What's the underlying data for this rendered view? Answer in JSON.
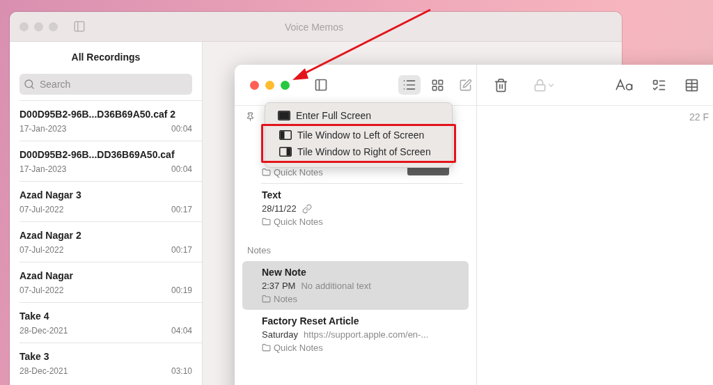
{
  "voice_memos": {
    "title": "Voice Memos",
    "heading": "All Recordings",
    "search": {
      "placeholder": "Search"
    },
    "recordings": [
      {
        "name": "D00D95B2-96B...D36B69A50.caf 2",
        "date": "17-Jan-2023",
        "duration": "00:04"
      },
      {
        "name": "D00D95B2-96B...DD36B69A50.caf",
        "date": "17-Jan-2023",
        "duration": "00:04"
      },
      {
        "name": "Azad Nagar 3",
        "date": "07-Jul-2022",
        "duration": "00:17"
      },
      {
        "name": "Azad Nagar 2",
        "date": "07-Jul-2022",
        "duration": "00:17"
      },
      {
        "name": "Azad Nagar",
        "date": "07-Jul-2022",
        "duration": "00:19"
      },
      {
        "name": "Take 4",
        "date": "28-Dec-2021",
        "duration": "04:04"
      },
      {
        "name": "Take 3",
        "date": "28-Dec-2021",
        "duration": "03:10"
      }
    ]
  },
  "notes": {
    "window_menu": [
      {
        "label": "Enter Full Screen",
        "kind": "full",
        "highlighted": false
      },
      {
        "label": "Tile Window to Left of Screen",
        "kind": "left",
        "highlighted": true
      },
      {
        "label": "Tile Window to Right of Screen",
        "kind": "right",
        "highlighted": true
      }
    ],
    "pinned": [
      {
        "kind": "photo",
        "folder": "Quick Notes"
      },
      {
        "kind": "link",
        "title": "Text",
        "date": "28/11/22",
        "folder": "Quick Notes"
      }
    ],
    "section": "Notes",
    "notes": [
      {
        "title": "New Note",
        "date": "2:37 PM",
        "preview": "No additional text",
        "folder": "Notes",
        "selected": true
      },
      {
        "title": "Factory Reset Article",
        "date": "Saturday",
        "preview": "https://support.apple.com/en-...",
        "folder": "Quick Notes",
        "selected": false
      }
    ],
    "editor_date": "22 F"
  }
}
